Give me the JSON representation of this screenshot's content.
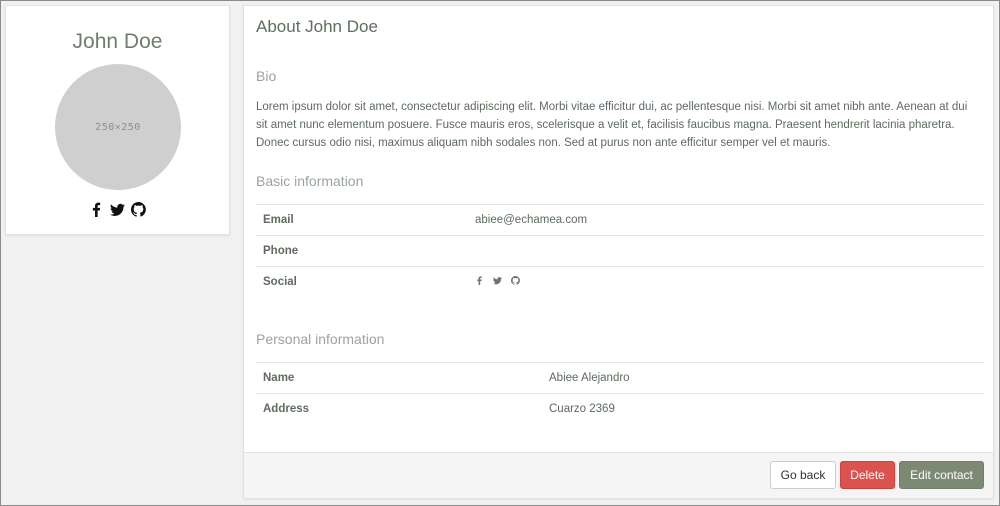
{
  "profile": {
    "name": "John Doe",
    "avatar_placeholder": "250×250",
    "social_icons": [
      "facebook-icon",
      "twitter-icon",
      "github-icon"
    ]
  },
  "main": {
    "title": "About John Doe",
    "bio": {
      "heading": "Bio",
      "text": "Lorem ipsum dolor sit amet, consectetur adipiscing elit. Morbi vitae efficitur dui, ac pellentesque nisi. Morbi sit amet nibh ante. Aenean at dui sit amet nunc elementum posuere. Fusce mauris eros, scelerisque a velit et, facilisis faucibus magna. Praesent hendrerit lacinia pharetra. Donec cursus odio nisi, maximus aliquam nibh sodales non. Sed at purus non ante efficitur semper vel et mauris."
    },
    "basic": {
      "heading": "Basic information",
      "rows": [
        {
          "label": "Email",
          "value": "abiee@echamea.com"
        },
        {
          "label": "Phone",
          "value": ""
        },
        {
          "label": "Social",
          "value": ""
        }
      ]
    },
    "personal": {
      "heading": "Personal information",
      "rows": [
        {
          "label": "Name",
          "value": "Abiee Alejandro"
        },
        {
          "label": "Address",
          "value": "Cuarzo 2369"
        }
      ]
    }
  },
  "footer": {
    "back_label": "Go back",
    "delete_label": "Delete",
    "edit_label": "Edit contact"
  },
  "colors": {
    "delete": "#d9534f",
    "edit": "#7c8a74"
  }
}
